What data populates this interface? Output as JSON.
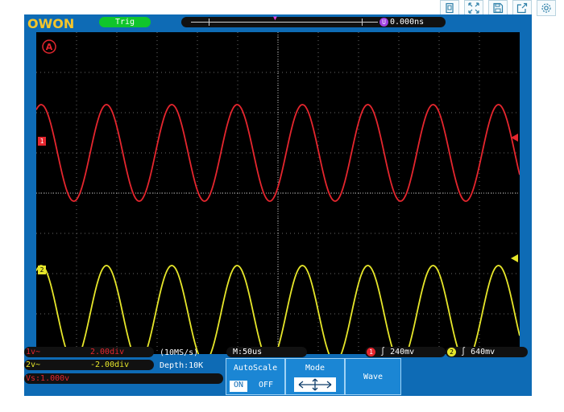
{
  "toolbar": {
    "icons": [
      "page-icon",
      "expand-icon",
      "save-icon",
      "share-icon",
      "settings-icon"
    ]
  },
  "scope": {
    "brand": "OWON",
    "trigger_status": "Trig",
    "horizontal_position": "0.000ns",
    "horizontal_marker": "U",
    "channel_A_marker": "A",
    "ch1_marker": "1",
    "ch2_marker": "2",
    "colors": {
      "frame": "#0E6BB5",
      "ch1": "#E5262E",
      "ch2": "#E6E62A",
      "trig": "#10C52C"
    }
  },
  "chart_data": {
    "type": "line",
    "grid": true,
    "series": [
      {
        "channel": "1",
        "color": "#E5262E",
        "cycles": 7.4,
        "amplitude_divisions": 2.4,
        "center_division": 3.0
      },
      {
        "channel": "2",
        "color": "#E6E62A",
        "cycles": 7.4,
        "amplitude_divisions": 2.4,
        "center_division": 7.0
      }
    ]
  },
  "status": {
    "ch1_scale": "2.00div",
    "ch1_prefix": "1v~",
    "ch2_prefix": "2v~",
    "ch2_scale": "-2.00div",
    "sample_rate": "(10MS/s)",
    "depth": "Depth:10K",
    "timebase": "M:50us",
    "ch1_trigger": "240mv",
    "ch2_trigger": "640mv",
    "ch1_measure": "Vs:1.000v"
  },
  "menu": {
    "autoscale_label": "AutoScale",
    "on_label": "ON",
    "off_label": "OFF",
    "mode_label": "Mode",
    "wave_label": "Wave"
  }
}
